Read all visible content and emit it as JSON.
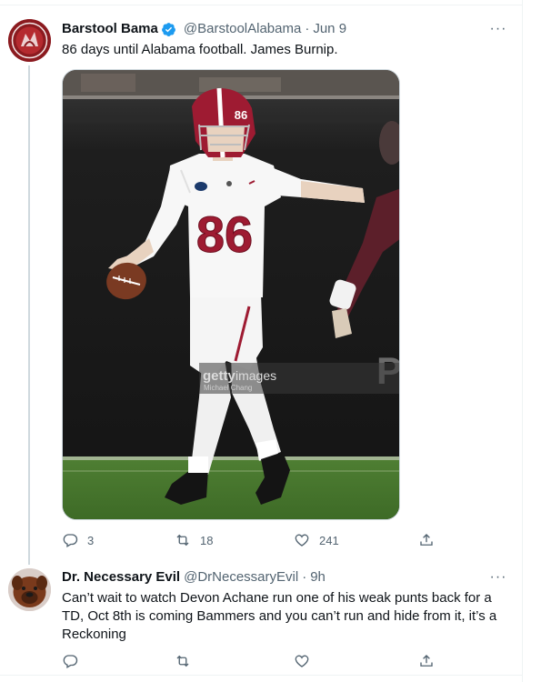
{
  "tweets": [
    {
      "display_name": "Barstool Bama",
      "handle": "@BarstoolAlabama",
      "separator": "·",
      "time": "Jun 9",
      "text": "86 days until Alabama football. James Burnip.",
      "media": {
        "jersey_number": "86",
        "watermark_brand": "getty",
        "watermark_word": "images",
        "watermark_credit": "Michael Chang",
        "scoreboard_letter": "P"
      },
      "stats": {
        "replies": "3",
        "retweets": "18",
        "likes": "241"
      }
    },
    {
      "display_name": "Dr. Necessary Evil",
      "handle": "@DrNecessaryEvil",
      "separator": "·",
      "time": "9h",
      "text": "Can’t wait to watch Devon Achane run one of his weak punts back for a TD, Oct 8th is coming Bammers and you can’t run and hide from it, it’s a Reckoning",
      "stats": {
        "replies": "",
        "retweets": "",
        "likes": ""
      }
    }
  ],
  "more_glyph": "···",
  "colors": {
    "verified": "#1d9bf0",
    "muted_text": "#536471",
    "crimson": "#9e1b32",
    "thread_line": "#cfd9de"
  },
  "icons": [
    "reply-icon",
    "retweet-icon",
    "like-icon",
    "share-icon",
    "verified-badge-icon",
    "more-icon"
  ]
}
